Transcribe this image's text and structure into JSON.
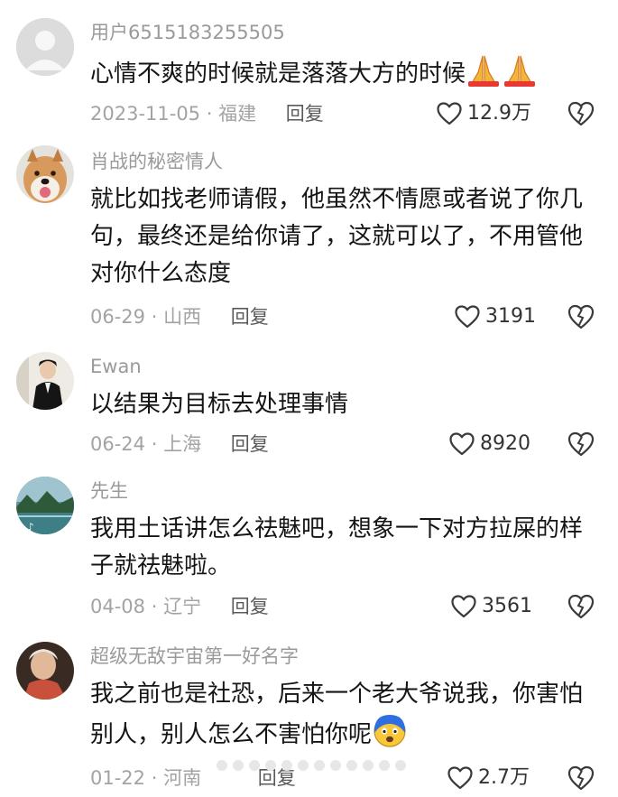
{
  "comments": [
    {
      "username": "用户6515183255505",
      "text": "心情不爽的时候就是落落大方的时候",
      "emoji": "pray-icon",
      "date": "2023-11-05",
      "location": "福建",
      "reply_label": "回复",
      "likes": "12.9万"
    },
    {
      "username": "肖战的秘密情人",
      "text": "就比如找老师请假，他虽然不情愿或者说了你几句，最终还是给你请了，这就可以了，不用管他对你什么态度",
      "date": "06-29",
      "location": "山西",
      "reply_label": "回复",
      "likes": "3191"
    },
    {
      "username": "Ewan",
      "text": "以结果为目标去处理事情",
      "date": "06-24",
      "location": "上海",
      "reply_label": "回复",
      "likes": "8920"
    },
    {
      "username": "先生",
      "text": "我用土话讲怎么祛魅吧，想象一下对方拉屎的样子就祛魅啦。",
      "date": "04-08",
      "location": "辽宁",
      "reply_label": "回复",
      "likes": "3561"
    },
    {
      "username": "超级无敌宇宙第一好名字",
      "text": "我之前也是社恐，后来一个老大爷说我，你害怕别人，别人怎么不害怕你呢",
      "emoji": "scared-face-icon",
      "date": "01-22",
      "location": "河南",
      "reply_label": "回复",
      "likes": "2.7万"
    }
  ],
  "colors": {
    "username": "#9a9a9a",
    "text": "#151515",
    "meta": "#a3a3a3"
  }
}
